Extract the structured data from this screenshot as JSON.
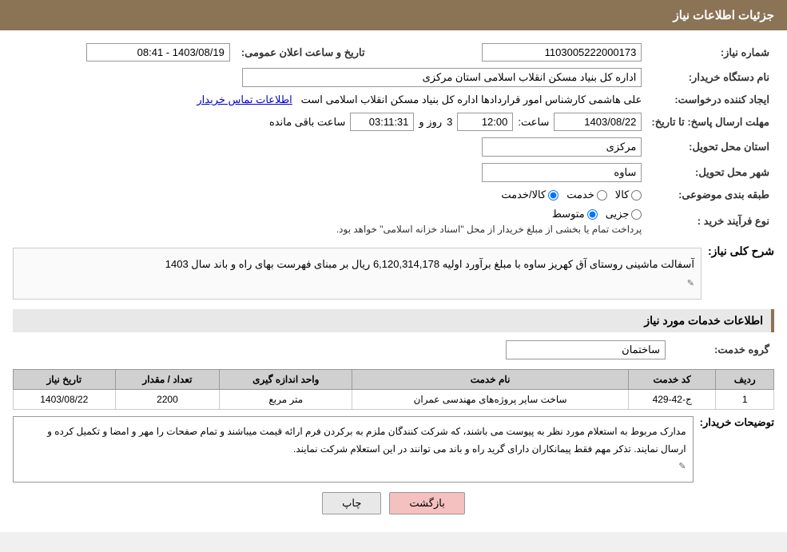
{
  "header": {
    "title": "جزئیات اطلاعات نیاز"
  },
  "fields": {
    "need_number_label": "شماره نیاز:",
    "need_number_value": "1103005222000173",
    "buyer_org_label": "نام دستگاه خریدار:",
    "buyer_org_value": "اداره کل بنیاد مسکن انقلاب اسلامی استان مرکزی",
    "requester_label": "ایجاد کننده درخواست:",
    "requester_value": "علی هاشمی کارشناس امور قراردادها اداره کل بنیاد مسکن انقلاب اسلامی است",
    "requester_link": "اطلاعات تماس خریدار",
    "response_deadline_label": "مهلت ارسال پاسخ: تا تاریخ:",
    "response_date": "1403/08/22",
    "response_time_label": "ساعت:",
    "response_time": "12:00",
    "response_day_label": "روز و",
    "response_days": "3",
    "response_remaining_label": "ساعت باقی مانده",
    "response_remaining": "03:11:31",
    "province_label": "استان محل تحویل:",
    "province_value": "مرکزی",
    "city_label": "شهر محل تحویل:",
    "city_value": "ساوه",
    "category_label": "طبقه بندی موضوعی:",
    "category_radio_kala": "کالا",
    "category_radio_khadamat": "خدمت",
    "category_radio_kala_khadamat": "کالا/خدمت",
    "category_selected": "kala",
    "process_label": "نوع فرآیند خرید :",
    "process_radio_jozei": "جزیی",
    "process_radio_motavaset": "متوسط",
    "process_note": "پرداخت تمام یا بخشی از مبلغ خریدار از محل \"اسناد خزانه اسلامی\" خواهد بود.",
    "announce_label": "تاریخ و ساعت اعلان عمومی:",
    "announce_value": "1403/08/19 - 08:41",
    "need_desc_label": "شرح کلی نیاز:",
    "need_desc_value": "آسفالت ماشینی روستای آق کهریز ساوه با مبلغ برآورد اولیه  6,120,314,178 ریال بر مبنای فهرست بهای راه و باند سال 1403",
    "services_info_title": "اطلاعات خدمات مورد نیاز",
    "service_group_label": "گروه خدمت:",
    "service_group_value": "ساختمان",
    "table": {
      "col_row": "ردیف",
      "col_code": "کد خدمت",
      "col_name": "نام خدمت",
      "col_unit_measure": "واحد اندازه گیری",
      "col_qty": "تعداد / مقدار",
      "col_date": "تاریخ نیاز",
      "rows": [
        {
          "row": "1",
          "code": "ج-42-429",
          "name": "ساخت سایر پروژه‌های مهندسی عمران",
          "unit": "متر مربع",
          "qty": "2200",
          "date": "1403/08/22"
        }
      ]
    },
    "buyer_desc_label": "توضیحات خریدار:",
    "buyer_desc_value": "مدارک مربوط به استعلام مورد نظر به پیوست می باشند، که شرکت کنندگان ملزم به برکردن فرم ارائه قیمت میباشند و تمام صفحات را مهر و امضا و تکمیل کرده و ارسال نمایند. تذکر مهم فقط پیمانکاران دارای گرید راه و باند می توانند در این استعلام شرکت نمایند.",
    "btn_back": "بازگشت",
    "btn_print": "چاپ"
  }
}
